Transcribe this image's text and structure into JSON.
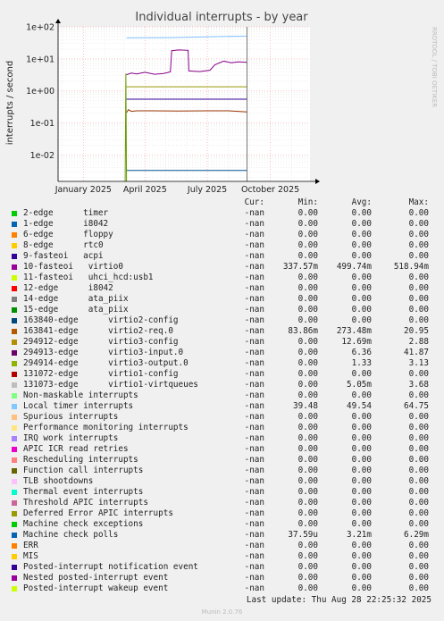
{
  "chart_data": {
    "type": "line",
    "title": "Individual interrupts - by year",
    "ylabel": "interrupts / second",
    "yscale": "log",
    "ylim": [
      0.0015,
      100
    ],
    "y_ticks": [
      {
        "v": 100,
        "label": "1e+02"
      },
      {
        "v": 10,
        "label": "1e+01"
      },
      {
        "v": 1,
        "label": "1e+00"
      },
      {
        "v": 0.1,
        "label": "1e-01"
      },
      {
        "v": 0.01,
        "label": "1e-02"
      }
    ],
    "xlim": [
      "2024-11-25",
      "2025-11-28"
    ],
    "x_ticks": [
      {
        "date": "2025-01-01",
        "label": "January 2025"
      },
      {
        "date": "2025-04-01",
        "label": "April 2025"
      },
      {
        "date": "2025-07-01",
        "label": "July 2025"
      },
      {
        "date": "2025-10-01",
        "label": "October 2025"
      }
    ],
    "now": "2025-08-28",
    "grid": true,
    "series": [
      {
        "name": "Local timer interrupts",
        "color": "#80C0FF",
        "points": [
          [
            "2025-03-05",
            45
          ],
          [
            "2025-05-10",
            46
          ],
          [
            "2025-07-12",
            49.5
          ],
          [
            "2025-08-28",
            51
          ]
        ]
      },
      {
        "name": "10-fasteoi virtio0",
        "color": "#880088",
        "points": [
          [
            "2025-03-05",
            3.2
          ],
          [
            "2025-03-12",
            3.6
          ],
          [
            "2025-03-20",
            3.4
          ],
          [
            "2025-04-01",
            3.8
          ],
          [
            "2025-04-15",
            3.3
          ],
          [
            "2025-04-28",
            3.5
          ],
          [
            "2025-05-08",
            3.9
          ],
          [
            "2025-05-10",
            18
          ],
          [
            "2025-05-20",
            19
          ],
          [
            "2025-06-03",
            18.5
          ],
          [
            "2025-06-04",
            4.2
          ],
          [
            "2025-06-20",
            4.0
          ],
          [
            "2025-07-05",
            4.4
          ],
          [
            "2025-07-12",
            6.5
          ],
          [
            "2025-07-25",
            8.5
          ],
          [
            "2025-08-05",
            7.5
          ],
          [
            "2025-08-15",
            8.0
          ],
          [
            "2025-08-28",
            7.8
          ]
        ]
      },
      {
        "name": "131073-edge virtio1-virtqueues",
        "color": "#999900",
        "points": [
          [
            "2025-03-05",
            1.35
          ],
          [
            "2025-08-28",
            1.35
          ]
        ]
      },
      {
        "name": "9-fasteoi acpi",
        "color": "#330099",
        "points": [
          [
            "2025-03-05",
            0.55
          ],
          [
            "2025-08-28",
            0.55
          ]
        ]
      },
      {
        "name": "163841-edge virtio2-req.0",
        "color": "#993300",
        "points": [
          [
            "2025-03-05",
            0.21
          ],
          [
            "2025-03-08",
            0.26
          ],
          [
            "2025-03-12",
            0.23
          ],
          [
            "2025-03-20",
            0.24
          ],
          [
            "2025-04-10",
            0.24
          ],
          [
            "2025-05-20",
            0.235
          ],
          [
            "2025-06-30",
            0.24
          ],
          [
            "2025-08-01",
            0.24
          ],
          [
            "2025-08-28",
            0.22
          ]
        ]
      },
      {
        "name": "Machine check polls",
        "color": "#005599",
        "points": [
          [
            "2025-03-05",
            0.0033
          ],
          [
            "2025-08-28",
            0.0033
          ]
        ]
      },
      {
        "name": "294913-edge virtio3-input.0",
        "color": "#669900",
        "points": [
          [
            "2025-03-03",
            0.0015
          ],
          [
            "2025-03-04",
            3.5
          ],
          [
            "2025-03-05",
            0.0015
          ]
        ]
      }
    ]
  },
  "legend": {
    "headers": {
      "cur": "Cur:",
      "min": "Min:",
      "avg": "Avg:",
      "max": "Max:"
    },
    "rows": [
      {
        "label": "2-edge      timer",
        "color": "#00CC00",
        "cur": "-nan",
        "min": "0.00",
        "avg": "0.00",
        "max": "0.00"
      },
      {
        "label": "1-edge      i8042",
        "color": "#0066B3",
        "cur": "-nan",
        "min": "0.00",
        "avg": "0.00",
        "max": "0.00"
      },
      {
        "label": "6-edge      floppy",
        "color": "#FF8000",
        "cur": "-nan",
        "min": "0.00",
        "avg": "0.00",
        "max": "0.00"
      },
      {
        "label": "8-edge      rtc0",
        "color": "#FFCC00",
        "cur": "-nan",
        "min": "0.00",
        "avg": "0.00",
        "max": "0.00"
      },
      {
        "label": "9-fasteoi   acpi",
        "color": "#330099",
        "cur": "-nan",
        "min": "0.00",
        "avg": "0.00",
        "max": "0.00"
      },
      {
        "label": "10-fasteoi   virtio0",
        "color": "#990099",
        "cur": "-nan",
        "min": "337.57m",
        "avg": "499.74m",
        "max": "518.94m"
      },
      {
        "label": "11-fasteoi   uhci_hcd:usb1",
        "color": "#CCFF00",
        "cur": "-nan",
        "min": "0.00",
        "avg": "0.00",
        "max": "0.00"
      },
      {
        "label": "12-edge      i8042",
        "color": "#FF0000",
        "cur": "-nan",
        "min": "0.00",
        "avg": "0.00",
        "max": "0.00"
      },
      {
        "label": "14-edge      ata_piix",
        "color": "#808080",
        "cur": "-nan",
        "min": "0.00",
        "avg": "0.00",
        "max": "0.00"
      },
      {
        "label": "15-edge      ata_piix",
        "color": "#008F00",
        "cur": "-nan",
        "min": "0.00",
        "avg": "0.00",
        "max": "0.00"
      },
      {
        "label": "163840-edge      virtio2-config",
        "color": "#00487D",
        "cur": "-nan",
        "min": "0.00",
        "avg": "0.00",
        "max": "0.00"
      },
      {
        "label": "163841-edge      virtio2-req.0",
        "color": "#B35A00",
        "cur": "-nan",
        "min": "83.86m",
        "avg": "273.48m",
        "max": "20.95"
      },
      {
        "label": "294912-edge      virtio3-config",
        "color": "#B38F00",
        "cur": "-nan",
        "min": "0.00",
        "avg": "12.69m",
        "max": "2.88"
      },
      {
        "label": "294913-edge      virtio3-input.0",
        "color": "#6B006B",
        "cur": "-nan",
        "min": "0.00",
        "avg": "6.36",
        "max": "41.87"
      },
      {
        "label": "294914-edge      virtio3-output.0",
        "color": "#8FB300",
        "cur": "-nan",
        "min": "0.00",
        "avg": "1.33",
        "max": "3.13"
      },
      {
        "label": "131072-edge      virtio1-config",
        "color": "#B30000",
        "cur": "-nan",
        "min": "0.00",
        "avg": "0.00",
        "max": "0.00"
      },
      {
        "label": "131073-edge      virtio1-virtqueues",
        "color": "#BEBEBE",
        "cur": "-nan",
        "min": "0.00",
        "avg": "5.05m",
        "max": "3.68"
      },
      {
        "label": "Non-maskable interrupts",
        "color": "#80FF80",
        "cur": "-nan",
        "min": "0.00",
        "avg": "0.00",
        "max": "0.00"
      },
      {
        "label": "Local timer interrupts",
        "color": "#80C9FF",
        "cur": "-nan",
        "min": "39.48",
        "avg": "49.54",
        "max": "64.75"
      },
      {
        "label": "Spurious interrupts",
        "color": "#FFC080",
        "cur": "-nan",
        "min": "0.00",
        "avg": "0.00",
        "max": "0.00"
      },
      {
        "label": "Performance monitoring interrupts",
        "color": "#FFE680",
        "cur": "-nan",
        "min": "0.00",
        "avg": "0.00",
        "max": "0.00"
      },
      {
        "label": "IRQ work interrupts",
        "color": "#AA80FF",
        "cur": "-nan",
        "min": "0.00",
        "avg": "0.00",
        "max": "0.00"
      },
      {
        "label": "APIC ICR read retries",
        "color": "#EE00CC",
        "cur": "-nan",
        "min": "0.00",
        "avg": "0.00",
        "max": "0.00"
      },
      {
        "label": "Rescheduling interrupts",
        "color": "#FF8080",
        "cur": "-nan",
        "min": "0.00",
        "avg": "0.00",
        "max": "0.00"
      },
      {
        "label": "Function call interrupts",
        "color": "#666600",
        "cur": "-nan",
        "min": "0.00",
        "avg": "0.00",
        "max": "0.00"
      },
      {
        "label": "TLB shootdowns",
        "color": "#FFBFFF",
        "cur": "-nan",
        "min": "0.00",
        "avg": "0.00",
        "max": "0.00"
      },
      {
        "label": "Thermal event interrupts",
        "color": "#00FFCC",
        "cur": "-nan",
        "min": "0.00",
        "avg": "0.00",
        "max": "0.00"
      },
      {
        "label": "Threshold APIC interrupts",
        "color": "#CC6699",
        "cur": "-nan",
        "min": "0.00",
        "avg": "0.00",
        "max": "0.00"
      },
      {
        "label": "Deferred Error APIC interrupts",
        "color": "#999900",
        "cur": "-nan",
        "min": "0.00",
        "avg": "0.00",
        "max": "0.00"
      },
      {
        "label": "Machine check exceptions",
        "color": "#00CC00",
        "cur": "-nan",
        "min": "0.00",
        "avg": "0.00",
        "max": "0.00"
      },
      {
        "label": "Machine check polls",
        "color": "#0066B3",
        "cur": "-nan",
        "min": "37.59u",
        "avg": "3.21m",
        "max": "6.29m"
      },
      {
        "label": "ERR",
        "color": "#FF8000",
        "cur": "-nan",
        "min": "0.00",
        "avg": "0.00",
        "max": "0.00"
      },
      {
        "label": "MIS",
        "color": "#FFCC00",
        "cur": "-nan",
        "min": "0.00",
        "avg": "0.00",
        "max": "0.00"
      },
      {
        "label": "Posted-interrupt notification event",
        "color": "#330099",
        "cur": "-nan",
        "min": "0.00",
        "avg": "0.00",
        "max": "0.00"
      },
      {
        "label": "Nested posted-interrupt event",
        "color": "#990099",
        "cur": "-nan",
        "min": "0.00",
        "avg": "0.00",
        "max": "0.00"
      },
      {
        "label": "Posted-interrupt wakeup event",
        "color": "#CCFF00",
        "cur": "-nan",
        "min": "0.00",
        "avg": "0.00",
        "max": "0.00"
      }
    ]
  },
  "footer": {
    "last_update": "Last update: Thu Aug 28 22:25:32 2025",
    "munin": "Munin 2.0.76"
  },
  "watermark": "RRDTOOL / TOBI OETIKER"
}
